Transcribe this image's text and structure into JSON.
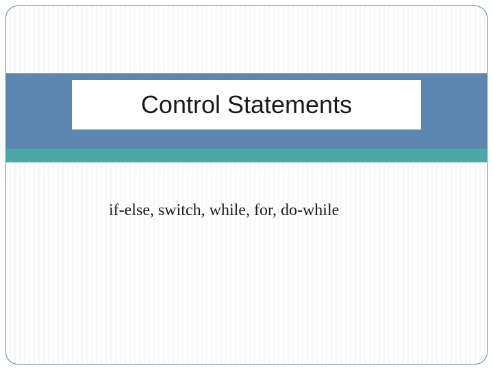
{
  "slide": {
    "title": "Control Statements",
    "subtitle": "if-else, switch, while, for, do-while"
  }
}
